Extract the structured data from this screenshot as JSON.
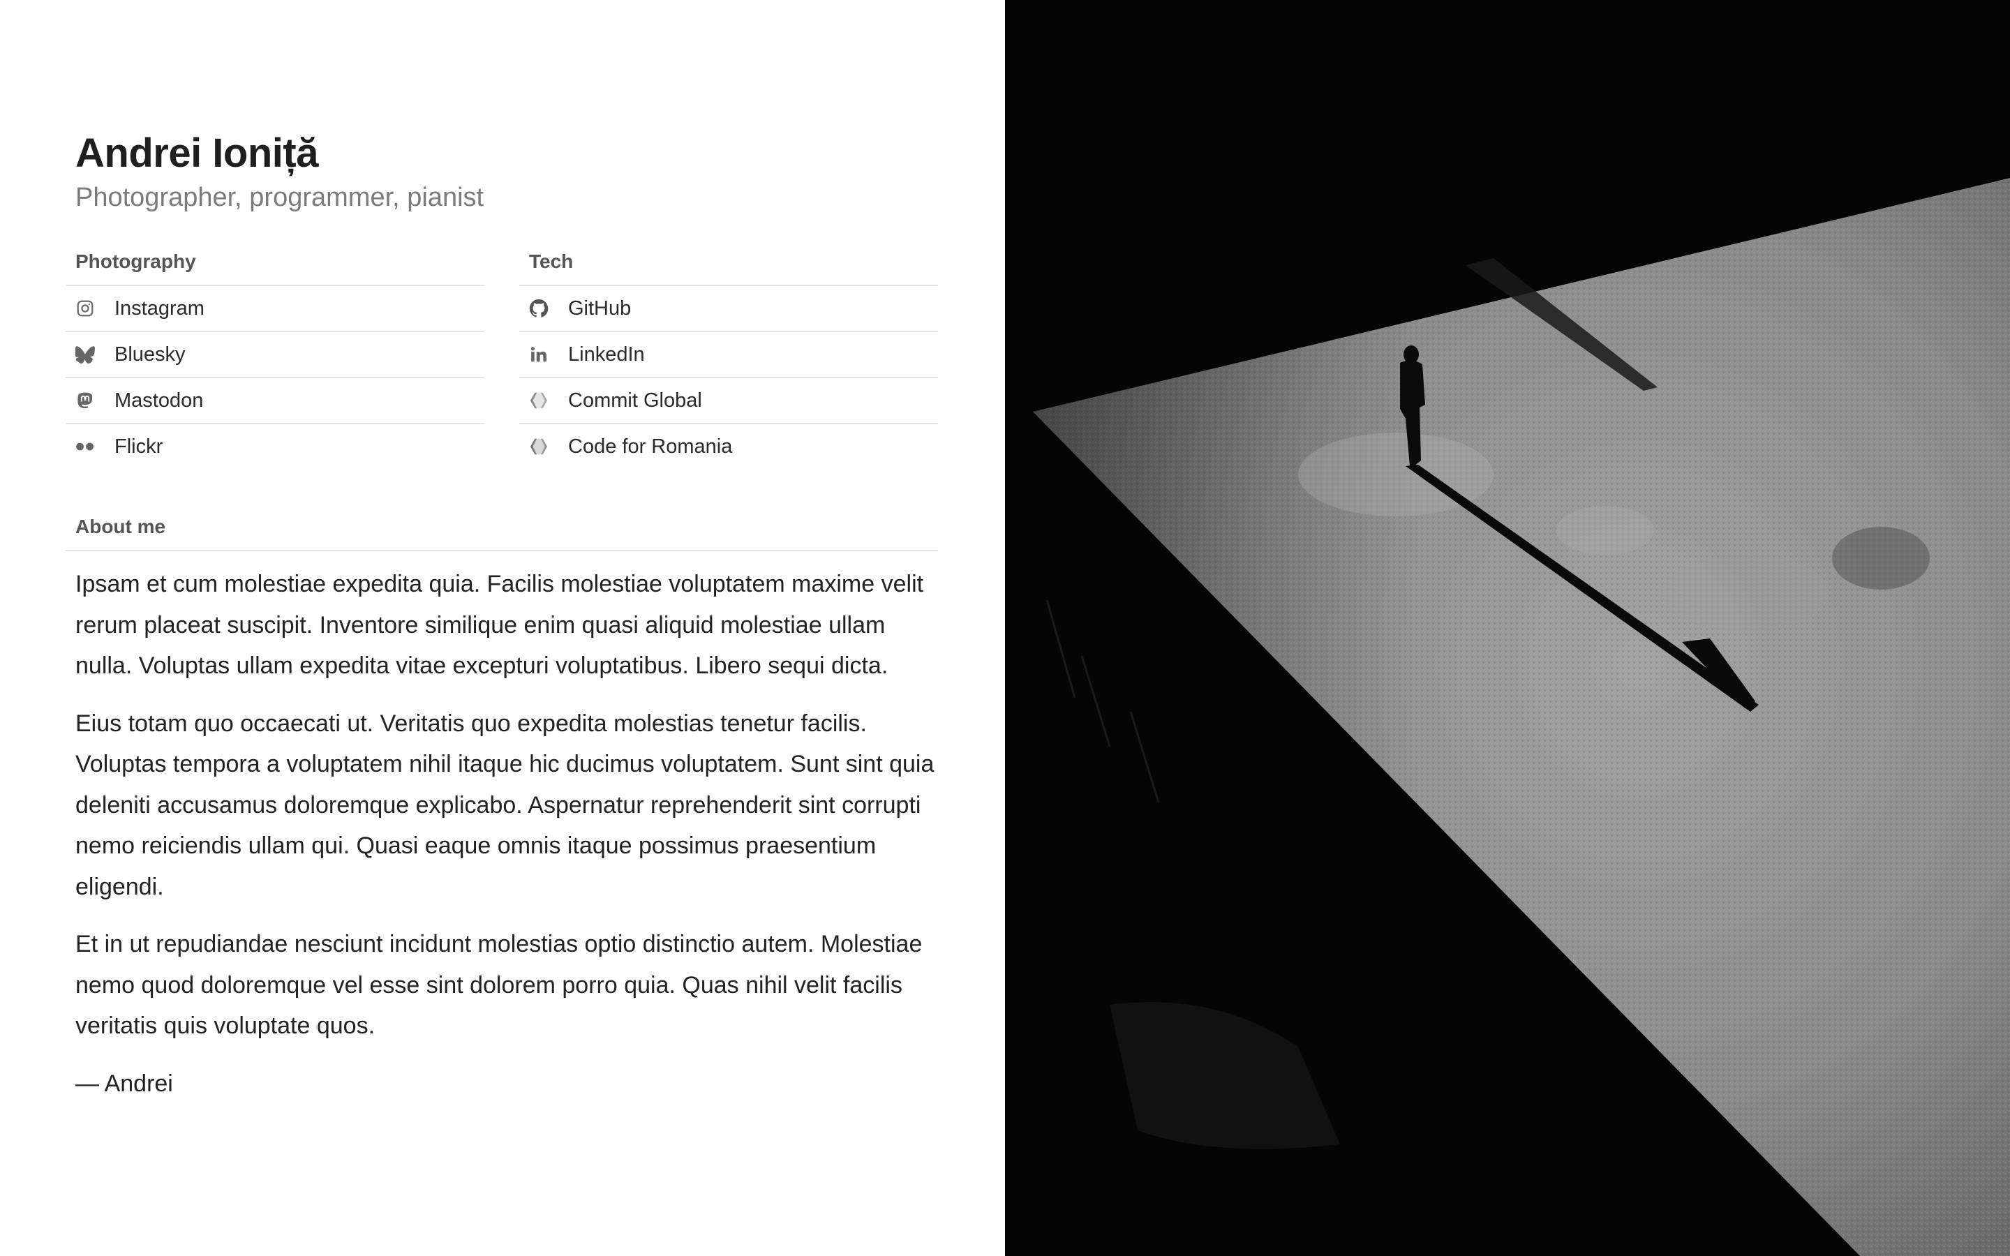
{
  "header": {
    "name": "Andrei Ioniță",
    "tagline": "Photographer, programmer, pianist"
  },
  "photography": {
    "heading": "Photography",
    "links": [
      {
        "label": "Instagram",
        "icon": "instagram-icon"
      },
      {
        "label": "Bluesky",
        "icon": "bluesky-icon"
      },
      {
        "label": "Mastodon",
        "icon": "mastodon-icon"
      },
      {
        "label": "Flickr",
        "icon": "flickr-icon"
      }
    ]
  },
  "tech": {
    "heading": "Tech",
    "links": [
      {
        "label": "GitHub",
        "icon": "github-icon"
      },
      {
        "label": "LinkedIn",
        "icon": "linkedin-icon"
      },
      {
        "label": "Commit Global",
        "icon": "commit-global-icon"
      },
      {
        "label": "Code for Romania",
        "icon": "code-for-romania-icon"
      }
    ]
  },
  "about": {
    "heading": "About me",
    "paragraphs": [
      "Ipsam et cum molestiae expedita quia. Facilis molestiae voluptatem maxime velit rerum placeat suscipit. Inventore similique enim quasi aliquid molestiae ullam nulla. Voluptas ullam expedita vitae excepturi voluptatibus. Libero sequi dicta.",
      "Eius totam quo occaecati ut. Veritatis quo expedita molestias tenetur facilis. Voluptas tempora a voluptatem nihil itaque hic ducimus voluptatem. Sunt sint quia deleniti accusamus doloremque explicabo. Aspernatur reprehenderit sint corrupti nemo reiciendis ullam qui. Quasi eaque omnis itaque possimus praesentium eligendi.",
      "Et in ut repudiandae nesciunt incidunt molestias optio distinctio autem. Molestiae nemo quod doloremque vel esse sint dolorem porro quia. Quas nihil velit facilis veritatis quis voluptate quos."
    ],
    "signoff": "— Andrei"
  },
  "colors": {
    "text": "#1f1f1f",
    "muted": "#7b7b7b",
    "divider": "#e5e5e5",
    "photo_dark": "#050505"
  }
}
